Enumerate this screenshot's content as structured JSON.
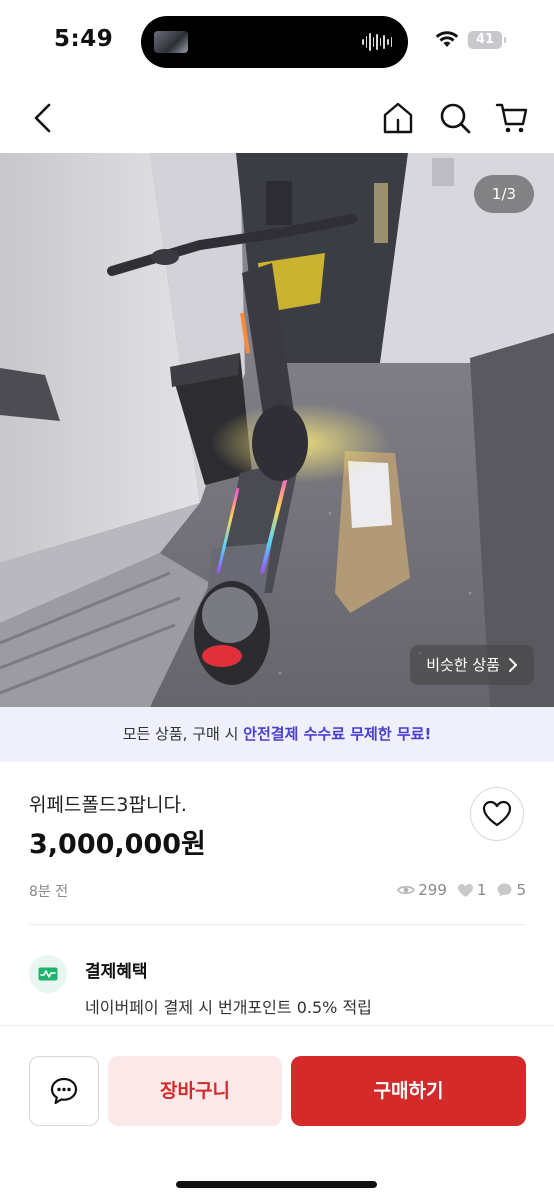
{
  "status_bar": {
    "time": "5:49",
    "battery_level": "41"
  },
  "nav": {
    "icons": [
      "back-icon",
      "home-icon",
      "search-icon",
      "cart-icon"
    ]
  },
  "product": {
    "image_counter": "1/3",
    "similar_label": "비슷한 상품",
    "title": "위페드폴드3팝니다.",
    "price": "3,000,000원",
    "posted_time": "8분 전",
    "views": "299",
    "likes": "1",
    "chats": "5"
  },
  "notice": {
    "prefix": "모든 상품, 구매 시 ",
    "highlight": "안전결제 수수료 무제한 무료!"
  },
  "benefit": {
    "title": "결제혜택",
    "description": "네이버페이 결제 시 번개포인트 0.5% 적립"
  },
  "actions": {
    "cart_label": "장바구니",
    "buy_label": "구매하기"
  },
  "colors": {
    "accent": "#d42a2a",
    "accent_soft": "#fbe9ea",
    "notice_highlight": "#4a3fd1",
    "notice_bg": "#eef0fb"
  }
}
